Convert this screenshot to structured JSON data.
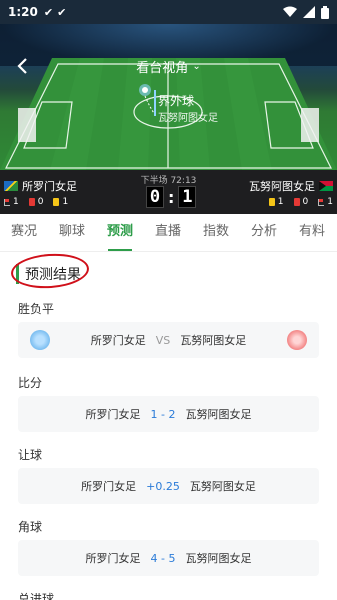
{
  "status_bar": {
    "time": "1:20",
    "check1": "✔",
    "check2": "✔"
  },
  "header": {
    "title": "看台视角",
    "caret": "⌄"
  },
  "event": {
    "title": "界外球",
    "team": "瓦努阿图女足"
  },
  "match": {
    "home": {
      "name": "所罗门女足",
      "corners": "1",
      "red": "0",
      "yellow": "1"
    },
    "away": {
      "name": "瓦努阿图女足",
      "corners": "1",
      "red": "0",
      "yellow": "1"
    },
    "clock": "下半场 72:13",
    "score_home": "0",
    "score_sep": ":",
    "score_away": "1"
  },
  "tabs": [
    {
      "label": "赛况"
    },
    {
      "label": "聊球"
    },
    {
      "label": "预测"
    },
    {
      "label": "直播"
    },
    {
      "label": "指数"
    },
    {
      "label": "分析"
    },
    {
      "label": "有料"
    }
  ],
  "active_tab": "预测",
  "prediction": {
    "heading": "预测结果",
    "groups": [
      {
        "label": "胜负平",
        "home": "所罗门女足",
        "value": "VS",
        "away": "瓦努阿图女足"
      },
      {
        "label": "比分",
        "home": "所罗门女足",
        "value": "1 - 2",
        "away": "瓦努阿图女足"
      },
      {
        "label": "让球",
        "home": "所罗门女足",
        "value": "+0.25",
        "away": "瓦努阿图女足"
      },
      {
        "label": "角球",
        "home": "所罗门女足",
        "value": "4 - 5",
        "away": "瓦努阿图女足"
      },
      {
        "label": "总进球"
      }
    ]
  },
  "colors": {
    "accent": "#2e9d4a",
    "value_blue": "#2a7bd8",
    "annotation_red": "#d0101a"
  }
}
